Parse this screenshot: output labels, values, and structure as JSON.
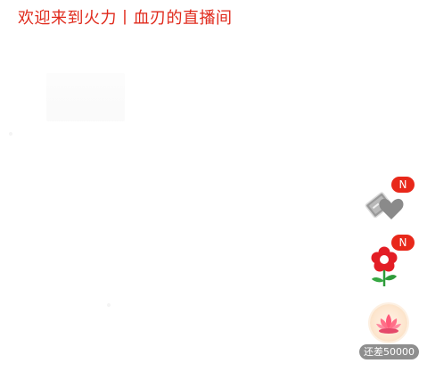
{
  "header": {
    "welcome_text": "欢迎来到火力丨血刃的直播间"
  },
  "side_panel": {
    "fan_item": {
      "icon": "fan-club-heart-icon",
      "badge": "N"
    },
    "flower_item": {
      "icon": "red-flower-icon",
      "badge": "N"
    },
    "lotus_item": {
      "icon": "lotus-gift-icon",
      "remain_label": "还差",
      "remain_value": "50000"
    }
  },
  "colors": {
    "accent_red": "#e02a1c",
    "badge_red": "#e8281a",
    "pill_gray": "#8e8e8e"
  }
}
